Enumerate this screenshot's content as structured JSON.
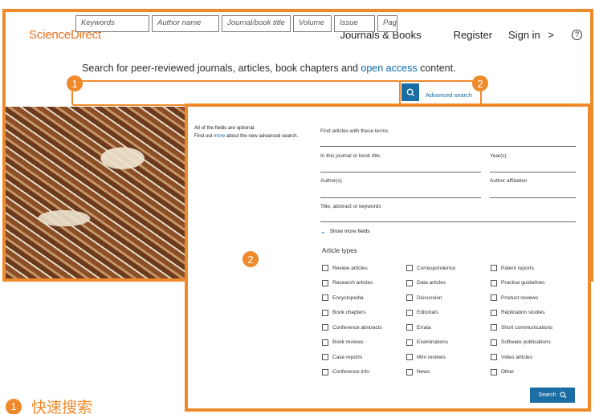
{
  "header": {
    "brand": "ScienceDirect",
    "nav_journals": "Journals & Books",
    "nav_register": "Register",
    "nav_signin": "Sign in",
    "signin_chevron": ">",
    "help_icon": "?"
  },
  "tagline": {
    "prefix": "Search for peer-reviewed journals, articles, book chapters and ",
    "link": "open access",
    "suffix": " content."
  },
  "quick_search": {
    "fields": [
      "Keywords",
      "Author name",
      "Journal/book title",
      "Volume",
      "Issue",
      "Pag"
    ],
    "advanced_link": "Advanced search"
  },
  "badges": {
    "one": "1",
    "two": "2"
  },
  "advanced": {
    "note_line1": "All of the fields are optional.",
    "note_prefix": "Find out ",
    "note_link": "more",
    "note_suffix": " about the new advanced search.",
    "labels": {
      "terms": "Find articles with these terms",
      "journal": "In this journal or book title",
      "year": "Year(s)",
      "authors": "Author(s)",
      "affiliation": "Author affiliation",
      "title_abstract": "Title, abstract or keywords"
    },
    "show_more": "Show more fields",
    "article_types_title": "Article types",
    "article_types": [
      [
        "Review articles",
        "Correspondence",
        "Patent reports"
      ],
      [
        "Research articles",
        "Data articles",
        "Practice guidelines"
      ],
      [
        "Encyclopedia",
        "Discussion",
        "Product reviews"
      ],
      [
        "Book chapters",
        "Editorials",
        "Replication studies"
      ],
      [
        "Conference abstracts",
        "Errata",
        "Short communications"
      ],
      [
        "Book reviews",
        "Examinations",
        "Software publications"
      ],
      [
        "Case reports",
        "Mini reviews",
        "Video articles"
      ],
      [
        "Conference info",
        "News",
        "Other"
      ]
    ],
    "search_button": "Search"
  },
  "caption": {
    "number": "1",
    "text": "快速搜索"
  },
  "colors": {
    "accent": "#ef8a2b",
    "brand": "#e9711c",
    "link": "#0b6aa7",
    "button": "#1b6ea3"
  }
}
